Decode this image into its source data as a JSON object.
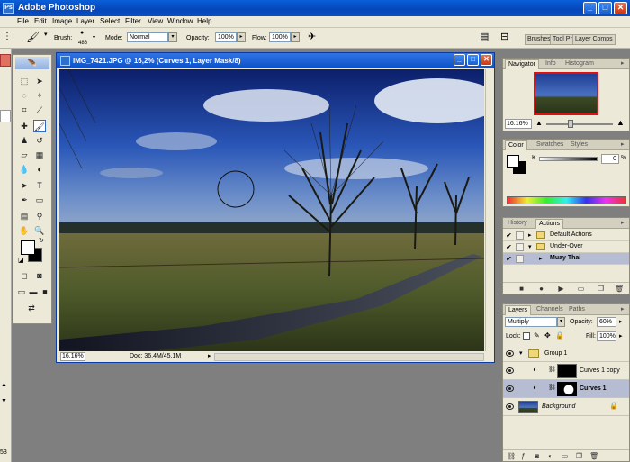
{
  "app": {
    "title": "Adobe Photoshop",
    "logo_text": "Ps"
  },
  "window_buttons": {
    "minimize": "_",
    "maximize": "□",
    "close": "✕"
  },
  "menu": [
    "File",
    "Edit",
    "Image",
    "Layer",
    "Select",
    "Filter",
    "View",
    "Window",
    "Help"
  ],
  "options_bar": {
    "brush_label": "Brush:",
    "brush_size": "486",
    "mode_label": "Mode:",
    "mode_value": "Normal",
    "opacity_label": "Opacity:",
    "opacity_value": "100%",
    "flow_label": "Flow:",
    "flow_value": "100%"
  },
  "palette_well_tabs": [
    "Brushes",
    "Tool Pr",
    "Layer Comps"
  ],
  "document": {
    "title": "IMG_7421.JPG @ 16,2% (Curves 1, Layer Mask/8)",
    "zoom": "16,16%",
    "doc_info": "Doc: 36,4M/45,1M"
  },
  "navigator": {
    "tabs": [
      "Navigator",
      "Info",
      "Histogram"
    ],
    "zoom": "16.16%"
  },
  "color": {
    "tabs": [
      "Color",
      "Swatches",
      "Styles"
    ],
    "channel": "K",
    "value": "0",
    "unit": "%"
  },
  "actions": {
    "tabs": [
      "History",
      "Actions"
    ],
    "rows": [
      {
        "label": "Default Actions",
        "type": "set"
      },
      {
        "label": "Under-Over",
        "type": "set"
      },
      {
        "label": "Muay Thai",
        "type": "action"
      }
    ]
  },
  "layers": {
    "tabs": [
      "Layers",
      "Channels",
      "Paths"
    ],
    "blend_mode": "Multiply",
    "opacity_label": "Opacity:",
    "opacity_value": "60%",
    "lock_label": "Lock:",
    "fill_label": "Fill:",
    "fill_value": "100%",
    "items": [
      {
        "name": "Group 1"
      },
      {
        "name": "Curves 1 copy"
      },
      {
        "name": "Curves 1"
      },
      {
        "name": "Background"
      }
    ]
  },
  "left_strip_number": "53",
  "colors": {
    "title_blue": "#0546b8",
    "panel_bg": "#ece9d8",
    "workspace": "#7f7f7f",
    "highlight": "#b6bdd2"
  }
}
